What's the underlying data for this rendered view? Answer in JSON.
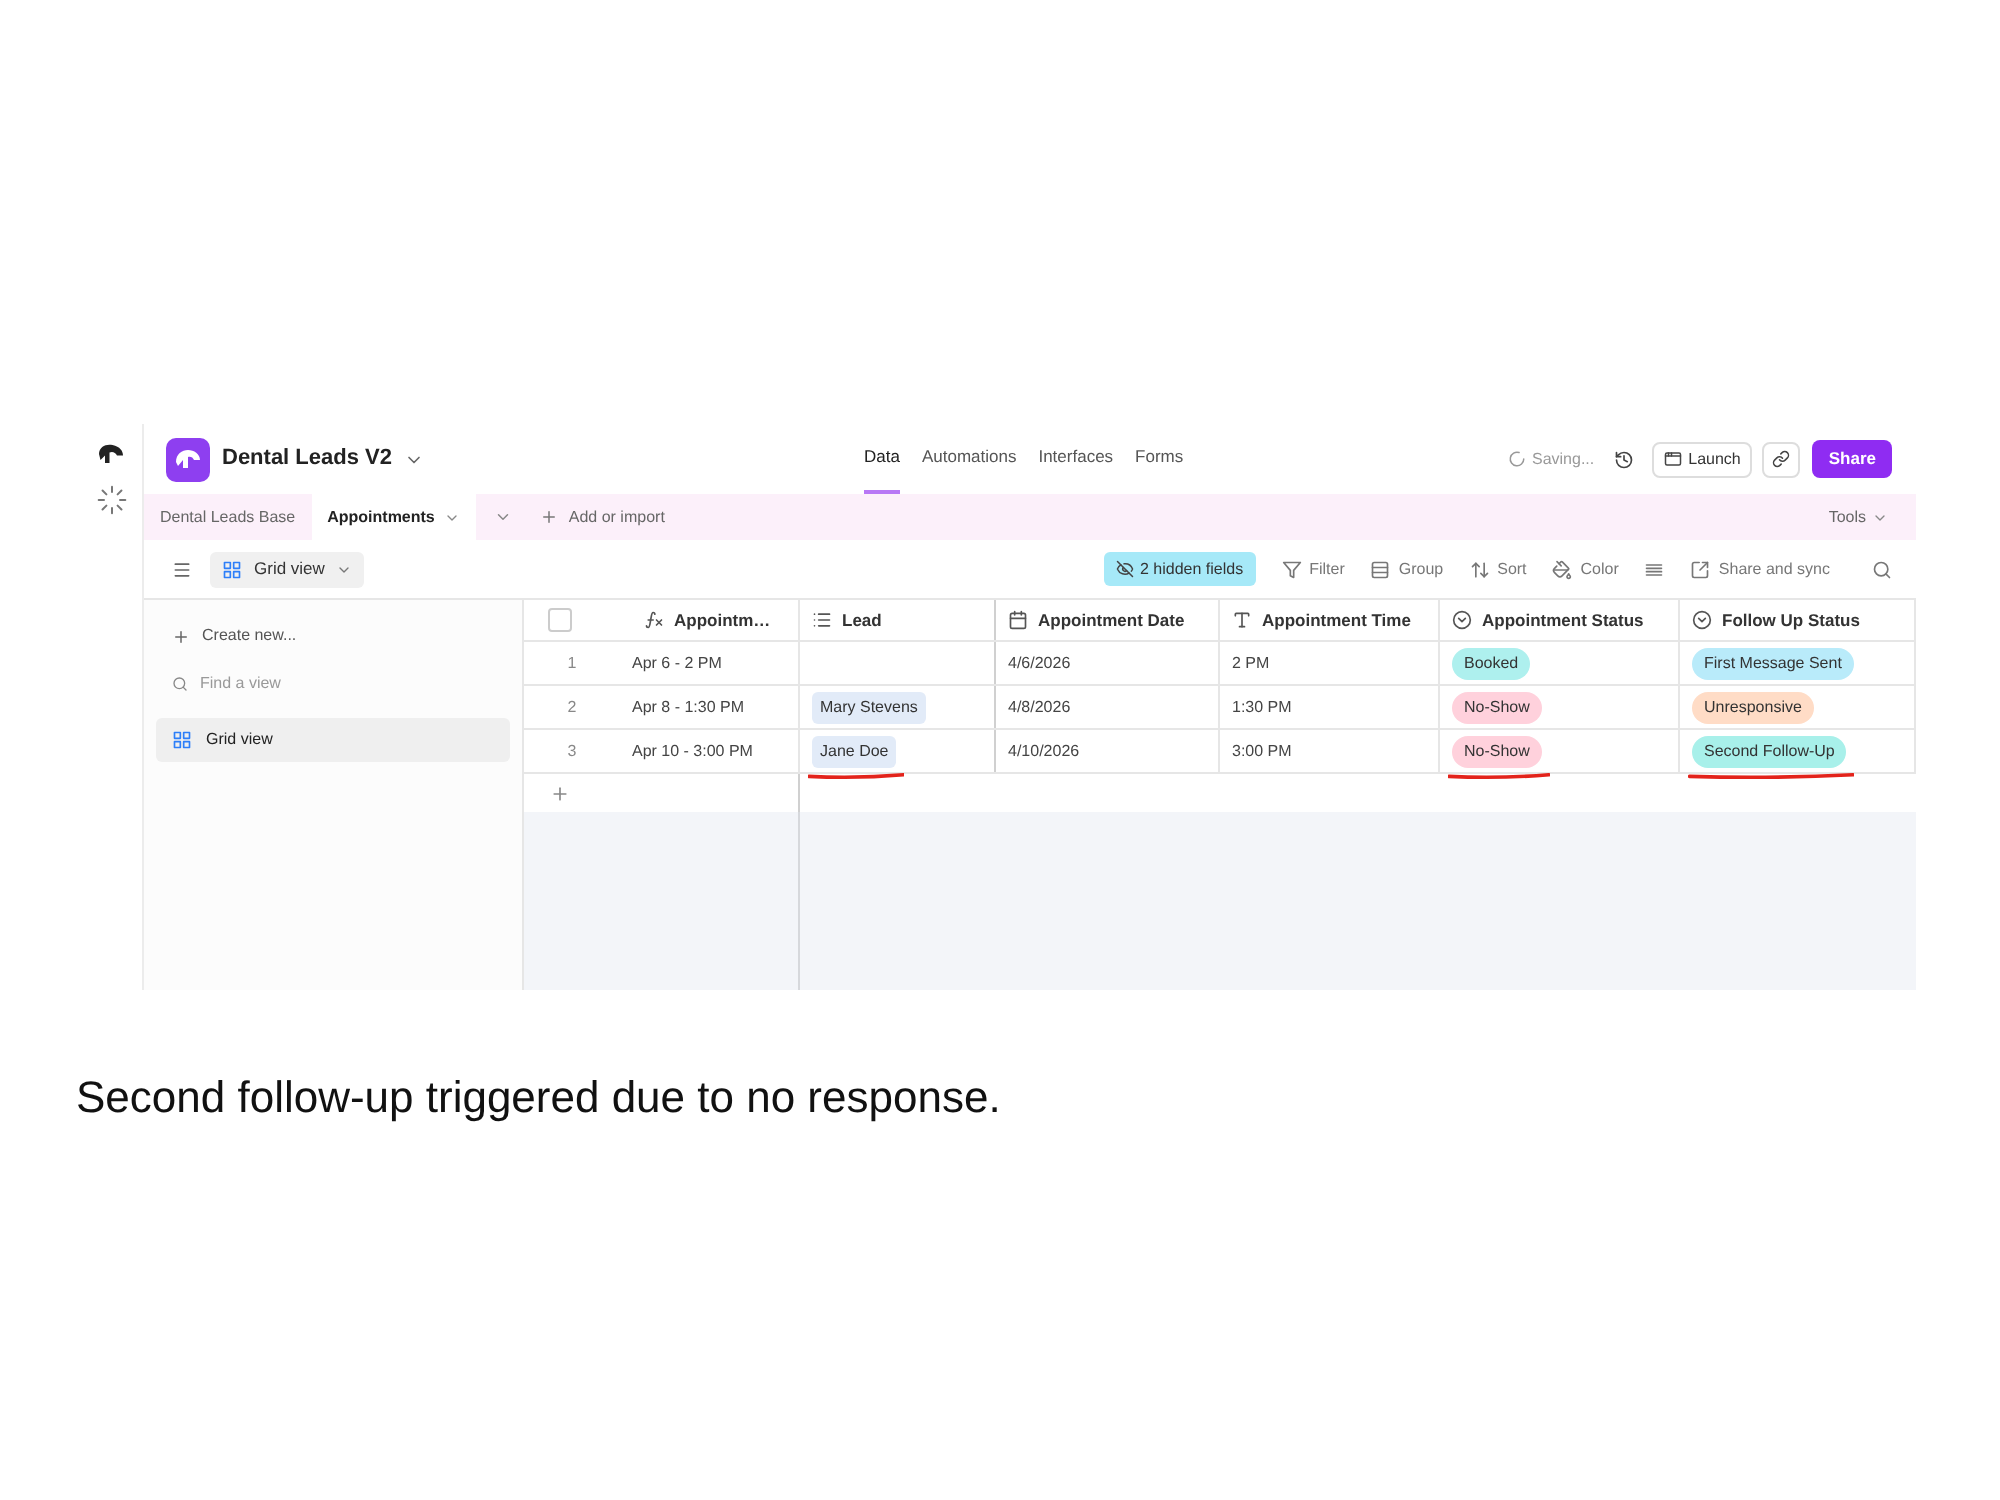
{
  "header": {
    "title": "Dental Leads V2",
    "nav": [
      {
        "label": "Data",
        "selected": true
      },
      {
        "label": "Automations",
        "selected": false
      },
      {
        "label": "Interfaces",
        "selected": false
      },
      {
        "label": "Forms",
        "selected": false
      }
    ],
    "status": "Saving...",
    "launch": "Launch",
    "share": "Share"
  },
  "tabs_bar": {
    "base": "Dental Leads Base",
    "tables": [
      {
        "label": "Appointments",
        "selected": true
      }
    ],
    "add": "Add or import",
    "tools": "Tools"
  },
  "toolbar": {
    "view": "Grid view",
    "hidden_fields": "2 hidden fields",
    "actions": [
      {
        "kind": "filter",
        "label": "Filter"
      },
      {
        "kind": "group",
        "label": "Group"
      },
      {
        "kind": "sort",
        "label": "Sort"
      },
      {
        "kind": "color",
        "label": "Color"
      },
      {
        "kind": "row_height"
      },
      {
        "kind": "share",
        "label": "Share and sync"
      }
    ]
  },
  "sidebar": {
    "create": "Create new...",
    "search": {
      "placeholder": "Find a view"
    },
    "views": [
      {
        "label": "Grid view",
        "selected": true
      }
    ]
  },
  "table": {
    "header_checkbox": {
      "checked": false
    },
    "columns": [
      {
        "kind": "formula",
        "label": "Appointm…"
      },
      {
        "kind": "link",
        "label": "Lead"
      },
      {
        "kind": "date",
        "label": "Appointment Date"
      },
      {
        "kind": "text",
        "label": "Appointment Time"
      },
      {
        "kind": "select",
        "label": "Appointment Status"
      },
      {
        "kind": "select",
        "label": "Follow Up Status"
      }
    ],
    "rows": [
      {
        "number": "1",
        "appointment": "Apr 6 - 2 PM",
        "date": "4/6/2026",
        "time": "2 PM",
        "status": {
          "label": "Booked",
          "color": "#aef0ee",
          "marked": false
        },
        "follow_up": {
          "label": "First Message Sent",
          "color": "#b9ebfa",
          "marked": false
        }
      },
      {
        "number": "2",
        "appointment": "Apr 8 - 1:30 PM",
        "lead": {
          "name": "Mary Stevens",
          "marked": false
        },
        "date": "4/8/2026",
        "time": "1:30 PM",
        "status": {
          "label": "No-Show",
          "color": "#ffd1dc",
          "marked": false
        },
        "follow_up": {
          "label": "Unresponsive",
          "color": "#ffdcc6",
          "marked": false
        }
      },
      {
        "number": "3",
        "appointment": "Apr 10 - 3:00 PM",
        "lead": {
          "name": "Jane Doe",
          "marked": true
        },
        "date": "4/10/2026",
        "time": "3:00 PM",
        "status": {
          "label": "No-Show",
          "color": "#ffd1dc",
          "marked": true
        },
        "follow_up": {
          "label": "Second Follow-Up",
          "color": "#a8f0ea",
          "marked": true
        }
      }
    ]
  },
  "caption": "Second follow-up triggered due to no response."
}
